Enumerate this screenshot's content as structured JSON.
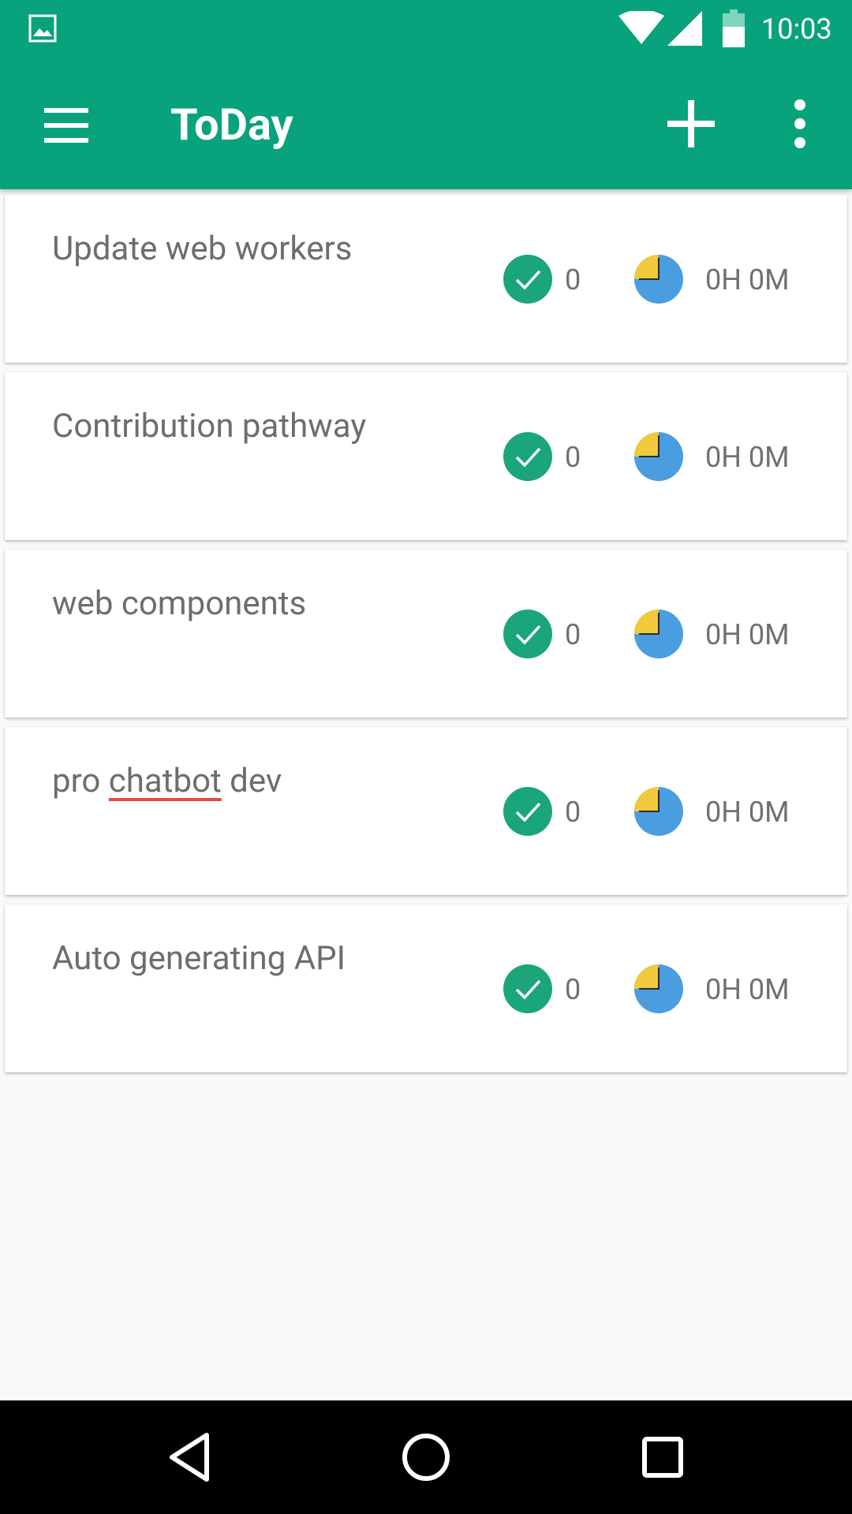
{
  "status_bar": {
    "time": "10:03",
    "icons": [
      "image-notification-icon",
      "wifi-icon",
      "cellular-signal-icon",
      "battery-icon"
    ]
  },
  "app_bar": {
    "title": "ToDay",
    "background_color": "#08a37c",
    "actions": [
      "menu-icon",
      "add-icon",
      "more-vert-icon"
    ]
  },
  "tasks": [
    {
      "title": "Update web workers",
      "completed_count": "0",
      "time_spent": "0H 0M"
    },
    {
      "title": "Contribution pathway",
      "completed_count": "0",
      "time_spent": "0H 0M"
    },
    {
      "title": "web components",
      "completed_count": "0",
      "time_spent": "0H 0M"
    },
    {
      "title_before": "pro ",
      "title_misspelled": "chatbot",
      "title_after": " dev",
      "completed_count": "0",
      "time_spent": "0H 0M"
    },
    {
      "title": "Auto generating API",
      "completed_count": "0",
      "time_spent": "0H 0M"
    }
  ],
  "colors": {
    "check_green": "#1aa57a",
    "pie_blue": "#4a9ee0",
    "pie_yellow": "#f0c93c",
    "text_gray": "#6d6d6d"
  },
  "nav_bar": {
    "icons": [
      "back-icon",
      "home-icon",
      "recents-icon"
    ]
  }
}
